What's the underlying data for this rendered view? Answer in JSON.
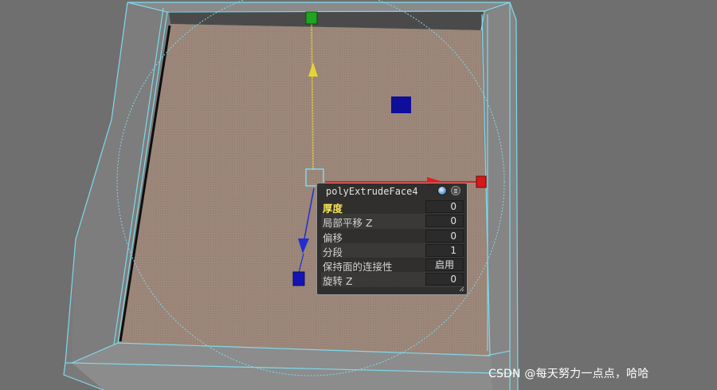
{
  "panel": {
    "title": "polyExtrudeFace4",
    "rows": [
      {
        "label": "厚度",
        "value": "0",
        "active": true
      },
      {
        "label": "局部平移 Z",
        "value": "0"
      },
      {
        "label": "偏移",
        "value": "0"
      },
      {
        "label": "分段",
        "value": "1"
      },
      {
        "label": "保持面的连接性",
        "value": "启用"
      },
      {
        "label": "旋转 Z",
        "value": "0"
      }
    ]
  },
  "watermark": "CSDN @每天努力一点点，哈哈",
  "colors": {
    "background": "#6f6f6f",
    "floor": "#9a8578",
    "wireframe": "#7fd9ea",
    "x_axis": "#e02020",
    "y_axis": "#e6d23a",
    "z_axis": "#2030d0",
    "handle_green": "#1fa51f",
    "handle_blue": "#1414b4",
    "label_active": "#f3e05a"
  }
}
